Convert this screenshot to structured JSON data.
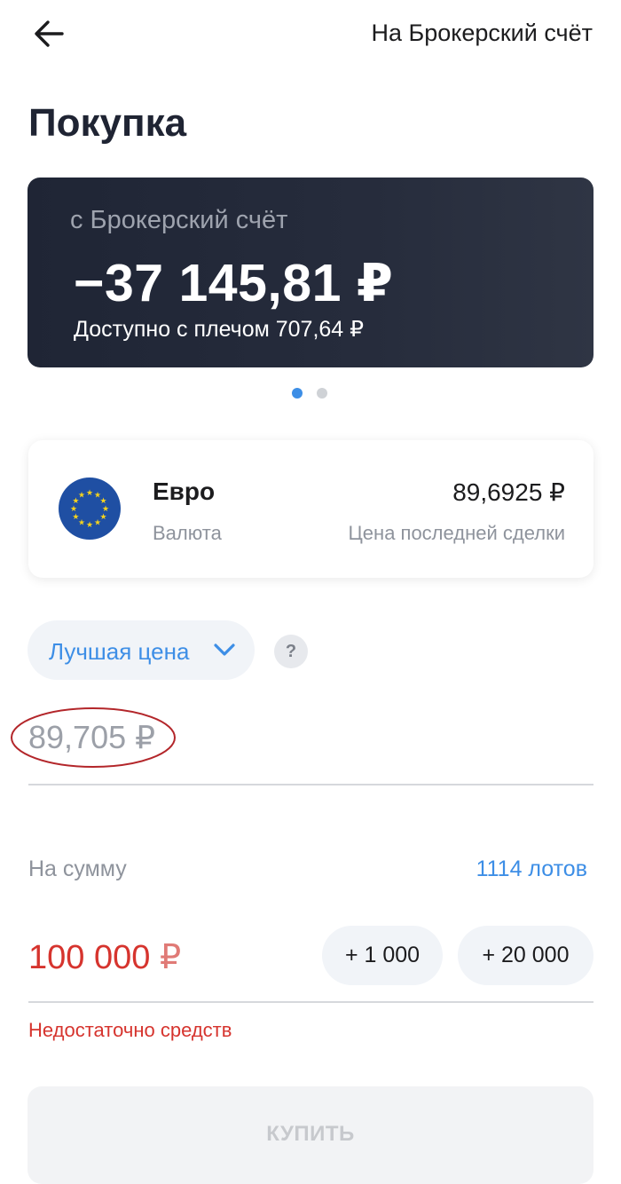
{
  "header": {
    "back_icon": "arrow-left-icon",
    "link_label": "На Брокерский счёт"
  },
  "page": {
    "title": "Покупка"
  },
  "account_card": {
    "from_label": "с Брокерский счёт",
    "balance": "−37 145,81 ₽",
    "leverage_label": "Доступно с плечом 707,64 ₽"
  },
  "carousel": {
    "total": 2,
    "active_index": 0
  },
  "instrument": {
    "icon": "eu-flag-icon",
    "name": "Евро",
    "type": "Валюта",
    "price": "89,6925 ₽",
    "price_label": "Цена последней сделки"
  },
  "order": {
    "price_mode_label": "Лучшая цена",
    "help_label": "?",
    "price_value": "89,705 ₽",
    "sum_label": "На сумму",
    "lots_label": "1114 лотов",
    "amount_value": "100 000",
    "amount_currency": "₽",
    "quick_add": [
      "+ 1 000",
      "+ 20 000"
    ],
    "error": "Недостаточно средств",
    "submit_label": "КУПИТЬ"
  },
  "colors": {
    "accent": "#3d8ee6",
    "error": "#d6342e",
    "card_dark": "#1f2535",
    "annotation": "#b3262a"
  }
}
